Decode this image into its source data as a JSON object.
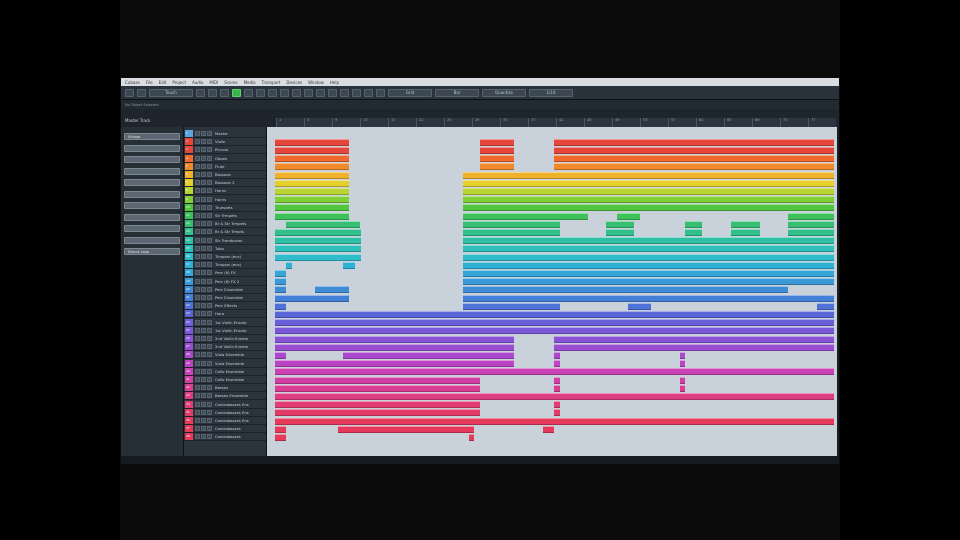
{
  "menu": [
    "Cubase",
    "File",
    "Edit",
    "Project",
    "Audio",
    "MIDI",
    "Scores",
    "Media",
    "Transport",
    "Devices",
    "Window",
    "Help"
  ],
  "toolbar": {
    "buttons": [
      "Touch",
      "Grid",
      "Bar",
      "Quantize",
      "1/16"
    ]
  },
  "info_line": {
    "cells": [
      "No Object Selected",
      "",
      "",
      "",
      "",
      ""
    ]
  },
  "master_track_label": "Master Track",
  "ruler_numbers": [
    "1",
    "5",
    "9",
    "13",
    "17",
    "21",
    "25",
    "29",
    "33",
    "37",
    "41",
    "45",
    "49",
    "53",
    "57",
    "61",
    "65",
    "69",
    "73",
    "77"
  ],
  "inspector": {
    "items": [
      "Strings",
      "",
      "",
      "",
      "",
      "",
      "",
      "",
      "",
      "",
      "Drums Loop"
    ]
  },
  "colors": {
    "background": "#000000",
    "project_bg": "#c9d2db",
    "toolbar_active": "#38b64a"
  },
  "tracks": [
    {
      "name": "Master",
      "color": "#5aa6e0"
    },
    {
      "name": "Violin",
      "color": "#e6463a"
    },
    {
      "name": "Piccolo",
      "color": "#e6463a"
    },
    {
      "name": "Oboes",
      "color": "#ef6a2c"
    },
    {
      "name": "Flute",
      "color": "#f08a2a"
    },
    {
      "name": "Bassoon",
      "color": "#efb22a"
    },
    {
      "name": "Bassoon 2",
      "color": "#e5cf2d"
    },
    {
      "name": "Horns",
      "color": "#b9d534"
    },
    {
      "name": "Horns",
      "color": "#7fcf35"
    },
    {
      "name": "Trumpets",
      "color": "#4fc63e"
    },
    {
      "name": "Str Trmpets",
      "color": "#3dc25a"
    },
    {
      "name": "Br & Str Trmpets",
      "color": "#36bf73"
    },
    {
      "name": "Br & Str Trmpts",
      "color": "#33bf8c"
    },
    {
      "name": "Str Trombones",
      "color": "#2fbfa4"
    },
    {
      "name": "Tuba",
      "color": "#2fbfba"
    },
    {
      "name": "Timpani (ens)",
      "color": "#2fbccb"
    },
    {
      "name": "Timpani (ens)",
      "color": "#2fb1d4"
    },
    {
      "name": "Perc (6) FX",
      "color": "#34a5d6"
    },
    {
      "name": "Perc (6) FX 2",
      "color": "#3a99d6"
    },
    {
      "name": "Perc Ensemble",
      "color": "#3f8cd6"
    },
    {
      "name": "Perc Ensemble",
      "color": "#437fd6"
    },
    {
      "name": "Perc Effects",
      "color": "#4f72d8"
    },
    {
      "name": "Harp",
      "color": "#5a66d8"
    },
    {
      "name": "1st Violin Ensmb",
      "color": "#6a5fd8"
    },
    {
      "name": "1st Violin Ensmb",
      "color": "#7a58d8"
    },
    {
      "name": "2nd Violin Ensmb",
      "color": "#8a52d6"
    },
    {
      "name": "2nd Violin Ensmb",
      "color": "#9b4dd2"
    },
    {
      "name": "Viola Ensemble",
      "color": "#ac48cc"
    },
    {
      "name": "Viola Ensemble",
      "color": "#bc44c2"
    },
    {
      "name": "Cello Ensemble",
      "color": "#c941b3"
    },
    {
      "name": "Cello Ensemble",
      "color": "#d23fa3"
    },
    {
      "name": "Basses",
      "color": "#d93d92"
    },
    {
      "name": "Basses Ensemble",
      "color": "#df3d83"
    },
    {
      "name": "Contrabasses Ens",
      "color": "#e23c75"
    },
    {
      "name": "Contrabasses Ens",
      "color": "#e33b68"
    },
    {
      "name": "Contrabasses Ens",
      "color": "#e53a5b"
    },
    {
      "name": "Contrabasses",
      "color": "#e6395a"
    },
    {
      "name": "Contrabasses",
      "color": "#e6395a"
    }
  ]
}
